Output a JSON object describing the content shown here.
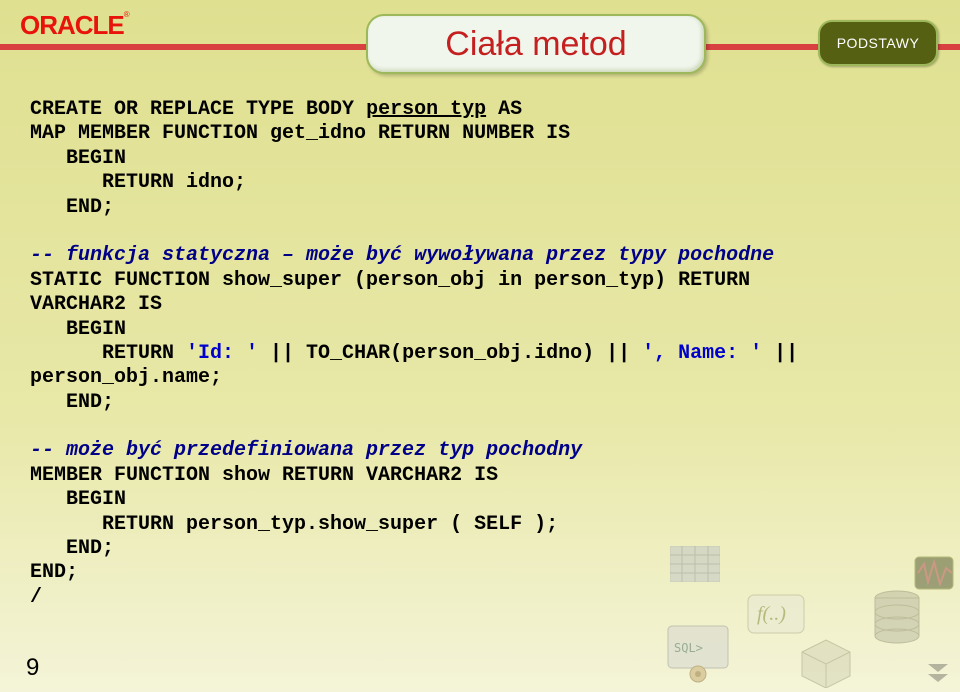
{
  "logo": {
    "text": "ORACLE",
    "tm": "®"
  },
  "title": "Ciała metod",
  "badge": "PODSTAWY",
  "code": {
    "l01a": "CREATE OR REPLACE TYPE BODY ",
    "l01b": "person_typ",
    "l01c": " AS",
    "l02": "MAP MEMBER FUNCTION get_idno RETURN NUMBER IS",
    "l03": "   BEGIN",
    "l04": "      RETURN idno;",
    "l05": "   END;",
    "l06": "-- funkcja statyczna – może być wywoływana przez typy pochodne",
    "l07": "STATIC FUNCTION show_super (person_obj in person_typ) RETURN",
    "l08": "VARCHAR2 IS",
    "l09": "   BEGIN",
    "l10a": "      RETURN ",
    "l10b": "'Id: '",
    "l10c": " || TO_CHAR(person_obj.idno) || ",
    "l10d": "', Name: '",
    "l10e": " ||",
    "l11": "person_obj.name;",
    "l12": "   END;",
    "l13": "-- może być przedefiniowana przez typ pochodny",
    "l14": "MEMBER FUNCTION show RETURN VARCHAR2 IS",
    "l15": "   BEGIN",
    "l16": "      RETURN person_typ.show_super ( SELF );",
    "l17": "   END;",
    "l18": "END;",
    "l19": "/"
  },
  "page_number": "9",
  "icons": {
    "sql_label": "SQL>"
  }
}
